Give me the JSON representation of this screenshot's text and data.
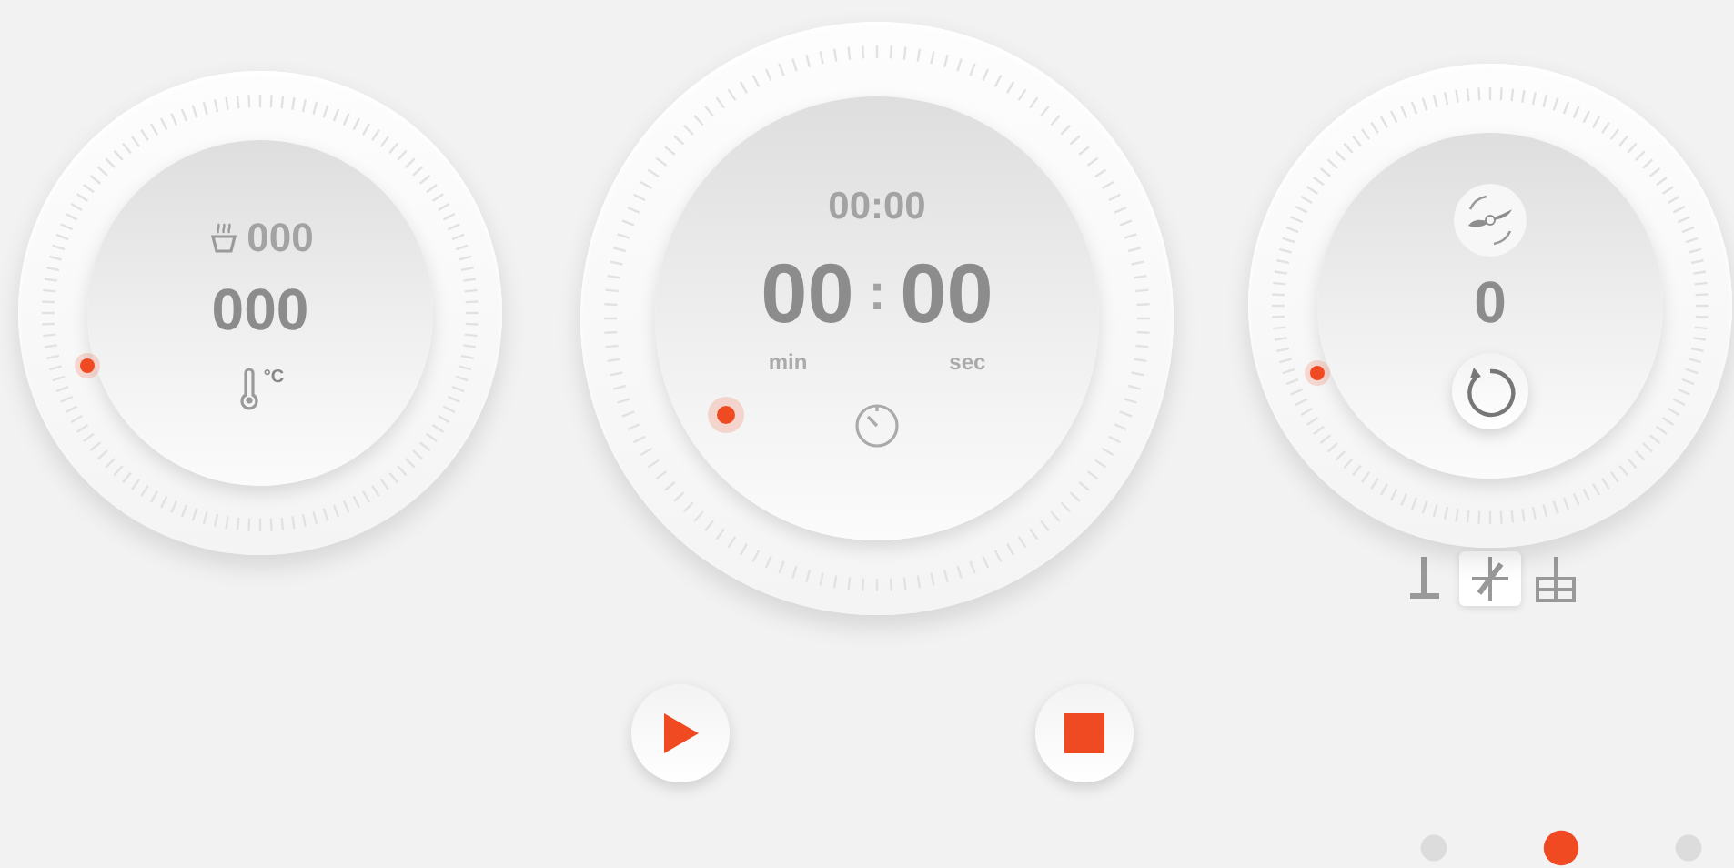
{
  "dials": [
    {
      "kind": "temperature",
      "setpoint": "000",
      "value": "000",
      "unit": "°C"
    },
    {
      "kind": "timer",
      "preset": "00:00",
      "minutes": "00",
      "separator": ":",
      "seconds": "00",
      "min_label": "min",
      "sec_label": "sec"
    },
    {
      "kind": "speed",
      "value": "0"
    }
  ],
  "blades": [
    {
      "selected": false
    },
    {
      "selected": true
    },
    {
      "selected": false
    }
  ],
  "pages": [
    {
      "selected": false
    },
    {
      "selected": true
    },
    {
      "selected": false
    }
  ]
}
